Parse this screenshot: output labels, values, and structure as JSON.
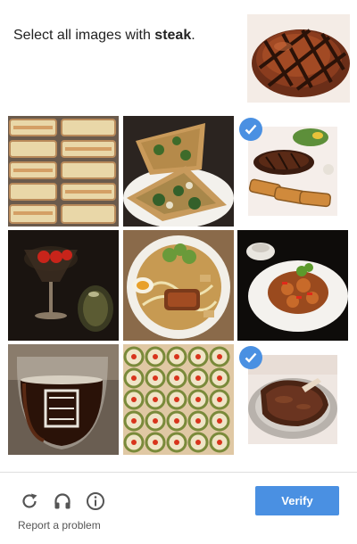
{
  "prompt": {
    "prefix": "Select all images with ",
    "target": "steak",
    "suffix": "."
  },
  "tiles": [
    {
      "subject": "sandwich platter",
      "selected": false
    },
    {
      "subject": "pizza slices",
      "selected": false
    },
    {
      "subject": "steak and toast",
      "selected": true
    },
    {
      "subject": "cocktail glass",
      "selected": false
    },
    {
      "subject": "ramen bowl",
      "selected": false
    },
    {
      "subject": "stir fry plate",
      "selected": false
    },
    {
      "subject": "beer glass",
      "selected": false
    },
    {
      "subject": "sushi platter",
      "selected": false
    },
    {
      "subject": "steak plate",
      "selected": true
    }
  ],
  "footer": {
    "icons": [
      "reload-icon",
      "audio-icon",
      "info-icon"
    ],
    "report_label": "Report a problem",
    "verify_label": "Verify"
  },
  "colors": {
    "accent": "#4a90e2",
    "divider": "#dfdfdf"
  }
}
